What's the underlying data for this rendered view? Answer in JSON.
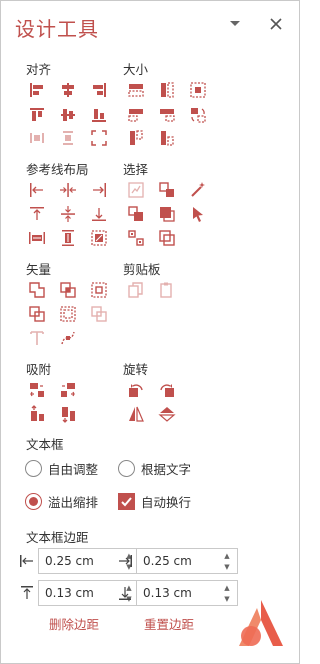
{
  "panel": {
    "title": "设计工具",
    "accent_color": "#c0504d",
    "disabled_color": "#e3b1af",
    "dropdown_icon": "chevron-down-icon",
    "close_icon": "close-icon"
  },
  "sections": {
    "align": {
      "label": "对齐"
    },
    "size": {
      "label": "大小"
    },
    "guides": {
      "label": "参考线布局"
    },
    "select": {
      "label": "选择"
    },
    "vector": {
      "label": "矢量"
    },
    "clipboard": {
      "label": "剪贴板"
    },
    "snap": {
      "label": "吸附"
    },
    "rotate": {
      "label": "旋转"
    },
    "textbox": {
      "label": "文本框"
    },
    "margins": {
      "label": "文本框边距"
    }
  },
  "textbox": {
    "auto_adjust": "自由调整",
    "fit_text": "根据文字",
    "overflow_shrink": "溢出缩排",
    "auto_wrap": "自动换行",
    "selected_option": "溢出缩排",
    "auto_wrap_checked": true
  },
  "margins": {
    "left": {
      "value": "0.25 cm",
      "icon": "margin-left-icon"
    },
    "right": {
      "value": "0.25 cm",
      "icon": "margin-right-icon"
    },
    "top": {
      "value": "0.13 cm",
      "icon": "margin-top-icon"
    },
    "bottom": {
      "value": "0.13 cm",
      "icon": "margin-bottom-icon"
    },
    "delete_label": "删除边距",
    "reset_label": "重置边距"
  }
}
